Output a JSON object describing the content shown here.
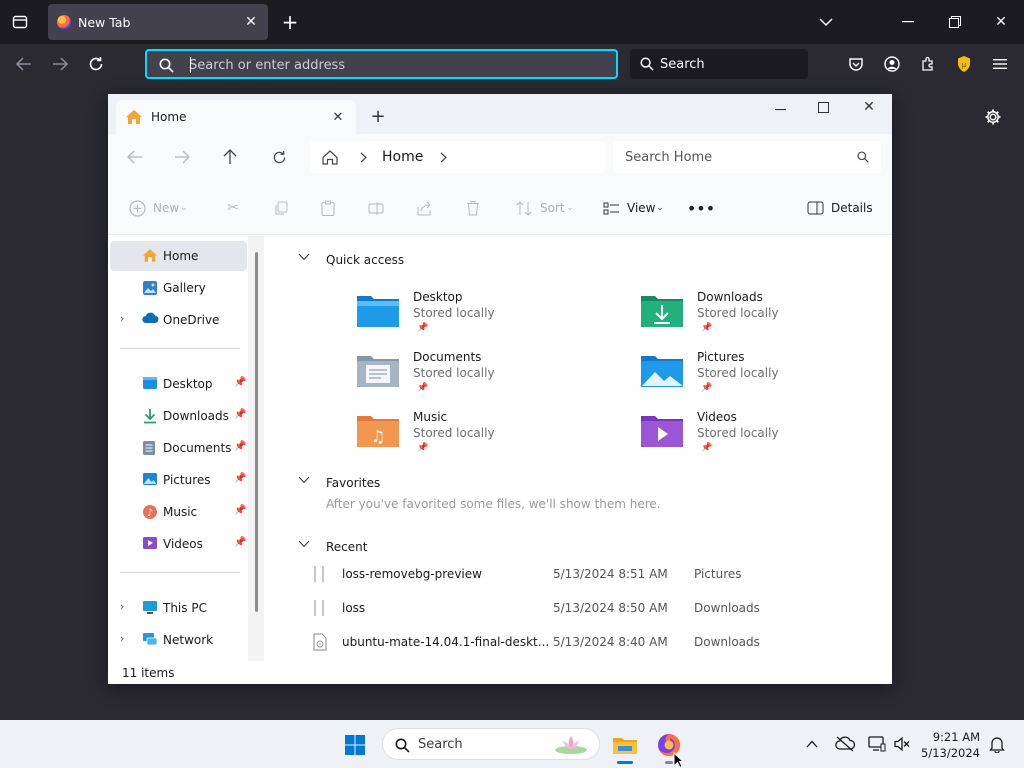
{
  "colors": {
    "accent": "#00ddff",
    "folder_yellow": "#f8c33a",
    "win_blue": "#0078d4"
  },
  "firefox": {
    "tab": {
      "title": "New Tab",
      "favicon": "firefox-icon"
    },
    "urlbar": {
      "placeholder": "Search or enter address"
    },
    "search": {
      "label": "Search"
    },
    "icons": [
      "list-all-tabs-icon",
      "new-tab-icon",
      "chevron-down-icon",
      "minimize-icon",
      "maximize-icon",
      "close-icon",
      "back-icon",
      "forward-icon",
      "reload-icon",
      "pocket-icon",
      "account-icon",
      "extensions-icon",
      "ublock-shield-icon",
      "menu-icon",
      "settings-gear-icon"
    ]
  },
  "explorer": {
    "tab": {
      "title": "Home"
    },
    "address": {
      "segment": "Home"
    },
    "search": {
      "placeholder": "Search Home"
    },
    "commands": {
      "new": "New",
      "sort": "Sort",
      "view": "View",
      "details": "Details"
    },
    "sidebar": {
      "top": [
        {
          "label": "Home",
          "icon": "home-icon",
          "selected": true
        },
        {
          "label": "Gallery",
          "icon": "gallery-icon"
        },
        {
          "label": "OneDrive",
          "icon": "onedrive-cloud-icon",
          "expandable": true
        }
      ],
      "pinned": [
        {
          "label": "Desktop",
          "icon": "desktop-folder-icon"
        },
        {
          "label": "Downloads",
          "icon": "downloads-icon"
        },
        {
          "label": "Documents",
          "icon": "documents-icon"
        },
        {
          "label": "Pictures",
          "icon": "pictures-icon"
        },
        {
          "label": "Music",
          "icon": "music-icon"
        },
        {
          "label": "Videos",
          "icon": "videos-icon"
        }
      ],
      "bottom": [
        {
          "label": "This PC",
          "icon": "this-pc-icon",
          "expandable": true
        },
        {
          "label": "Network",
          "icon": "network-icon",
          "expandable": true
        }
      ]
    },
    "sections": {
      "quick_access": "Quick access",
      "favorites": "Favorites",
      "recent": "Recent"
    },
    "quick_access": [
      {
        "name": "Desktop",
        "sub": "Stored locally",
        "icon": "desktop-folder-icon"
      },
      {
        "name": "Downloads",
        "sub": "Stored locally",
        "icon": "downloads-folder-icon"
      },
      {
        "name": "Documents",
        "sub": "Stored locally",
        "icon": "documents-folder-icon"
      },
      {
        "name": "Pictures",
        "sub": "Stored locally",
        "icon": "pictures-folder-icon"
      },
      {
        "name": "Music",
        "sub": "Stored locally",
        "icon": "music-folder-icon"
      },
      {
        "name": "Videos",
        "sub": "Stored locally",
        "icon": "videos-folder-icon"
      }
    ],
    "favorites_empty": "After you've favorited some files, we'll show them here.",
    "recent": [
      {
        "name": "loss-removebg-preview",
        "date": "5/13/2024 8:51 AM",
        "location": "Pictures"
      },
      {
        "name": "loss",
        "date": "5/13/2024 8:50 AM",
        "location": "Downloads"
      },
      {
        "name": "ubuntu-mate-14.04.1-final-deskt...",
        "date": "5/13/2024 8:40 AM",
        "location": "Downloads"
      }
    ],
    "status": "11 items"
  },
  "taskbar": {
    "search_label": "Search",
    "time": "9:21 AM",
    "date": "5/13/2024",
    "icons": [
      "start-icon",
      "search-icon",
      "search-highlight-lotus-icon",
      "file-explorer-icon",
      "firefox-icon",
      "chevron-up-icon",
      "onedrive-offline-icon",
      "display-icon",
      "speaker-muted-icon",
      "notifications-bell-icon"
    ]
  }
}
